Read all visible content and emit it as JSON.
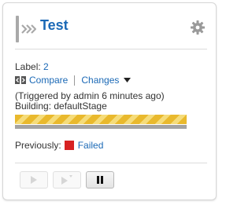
{
  "pipeline": {
    "name": "Test",
    "status_color": "#a9a9a9"
  },
  "label": {
    "prefix": "Label:",
    "value": "2"
  },
  "links": {
    "compare": "Compare",
    "changes": "Changes"
  },
  "trigger": {
    "text": "(Triggered by admin 6 minutes ago)",
    "building": "Building: defaultStage"
  },
  "progress": {
    "fraction": 1.0,
    "color": "#e9b92d"
  },
  "previous": {
    "prefix": "Previously:",
    "status": "Failed",
    "status_color": "#d72222"
  },
  "controls": {
    "play": {
      "icon": "play-icon",
      "enabled": false
    },
    "play_with_options": {
      "icon": "play-with-options-icon",
      "enabled": false
    },
    "pause": {
      "icon": "pause-icon",
      "enabled": true
    }
  },
  "icons": {
    "header": "pipeline-arrows-icon",
    "settings": "gear-icon",
    "compare": "compare-icon",
    "dropdown": "caret-down-icon"
  },
  "colors": {
    "link": "#1b69b6",
    "border": "#d6d6d6"
  }
}
